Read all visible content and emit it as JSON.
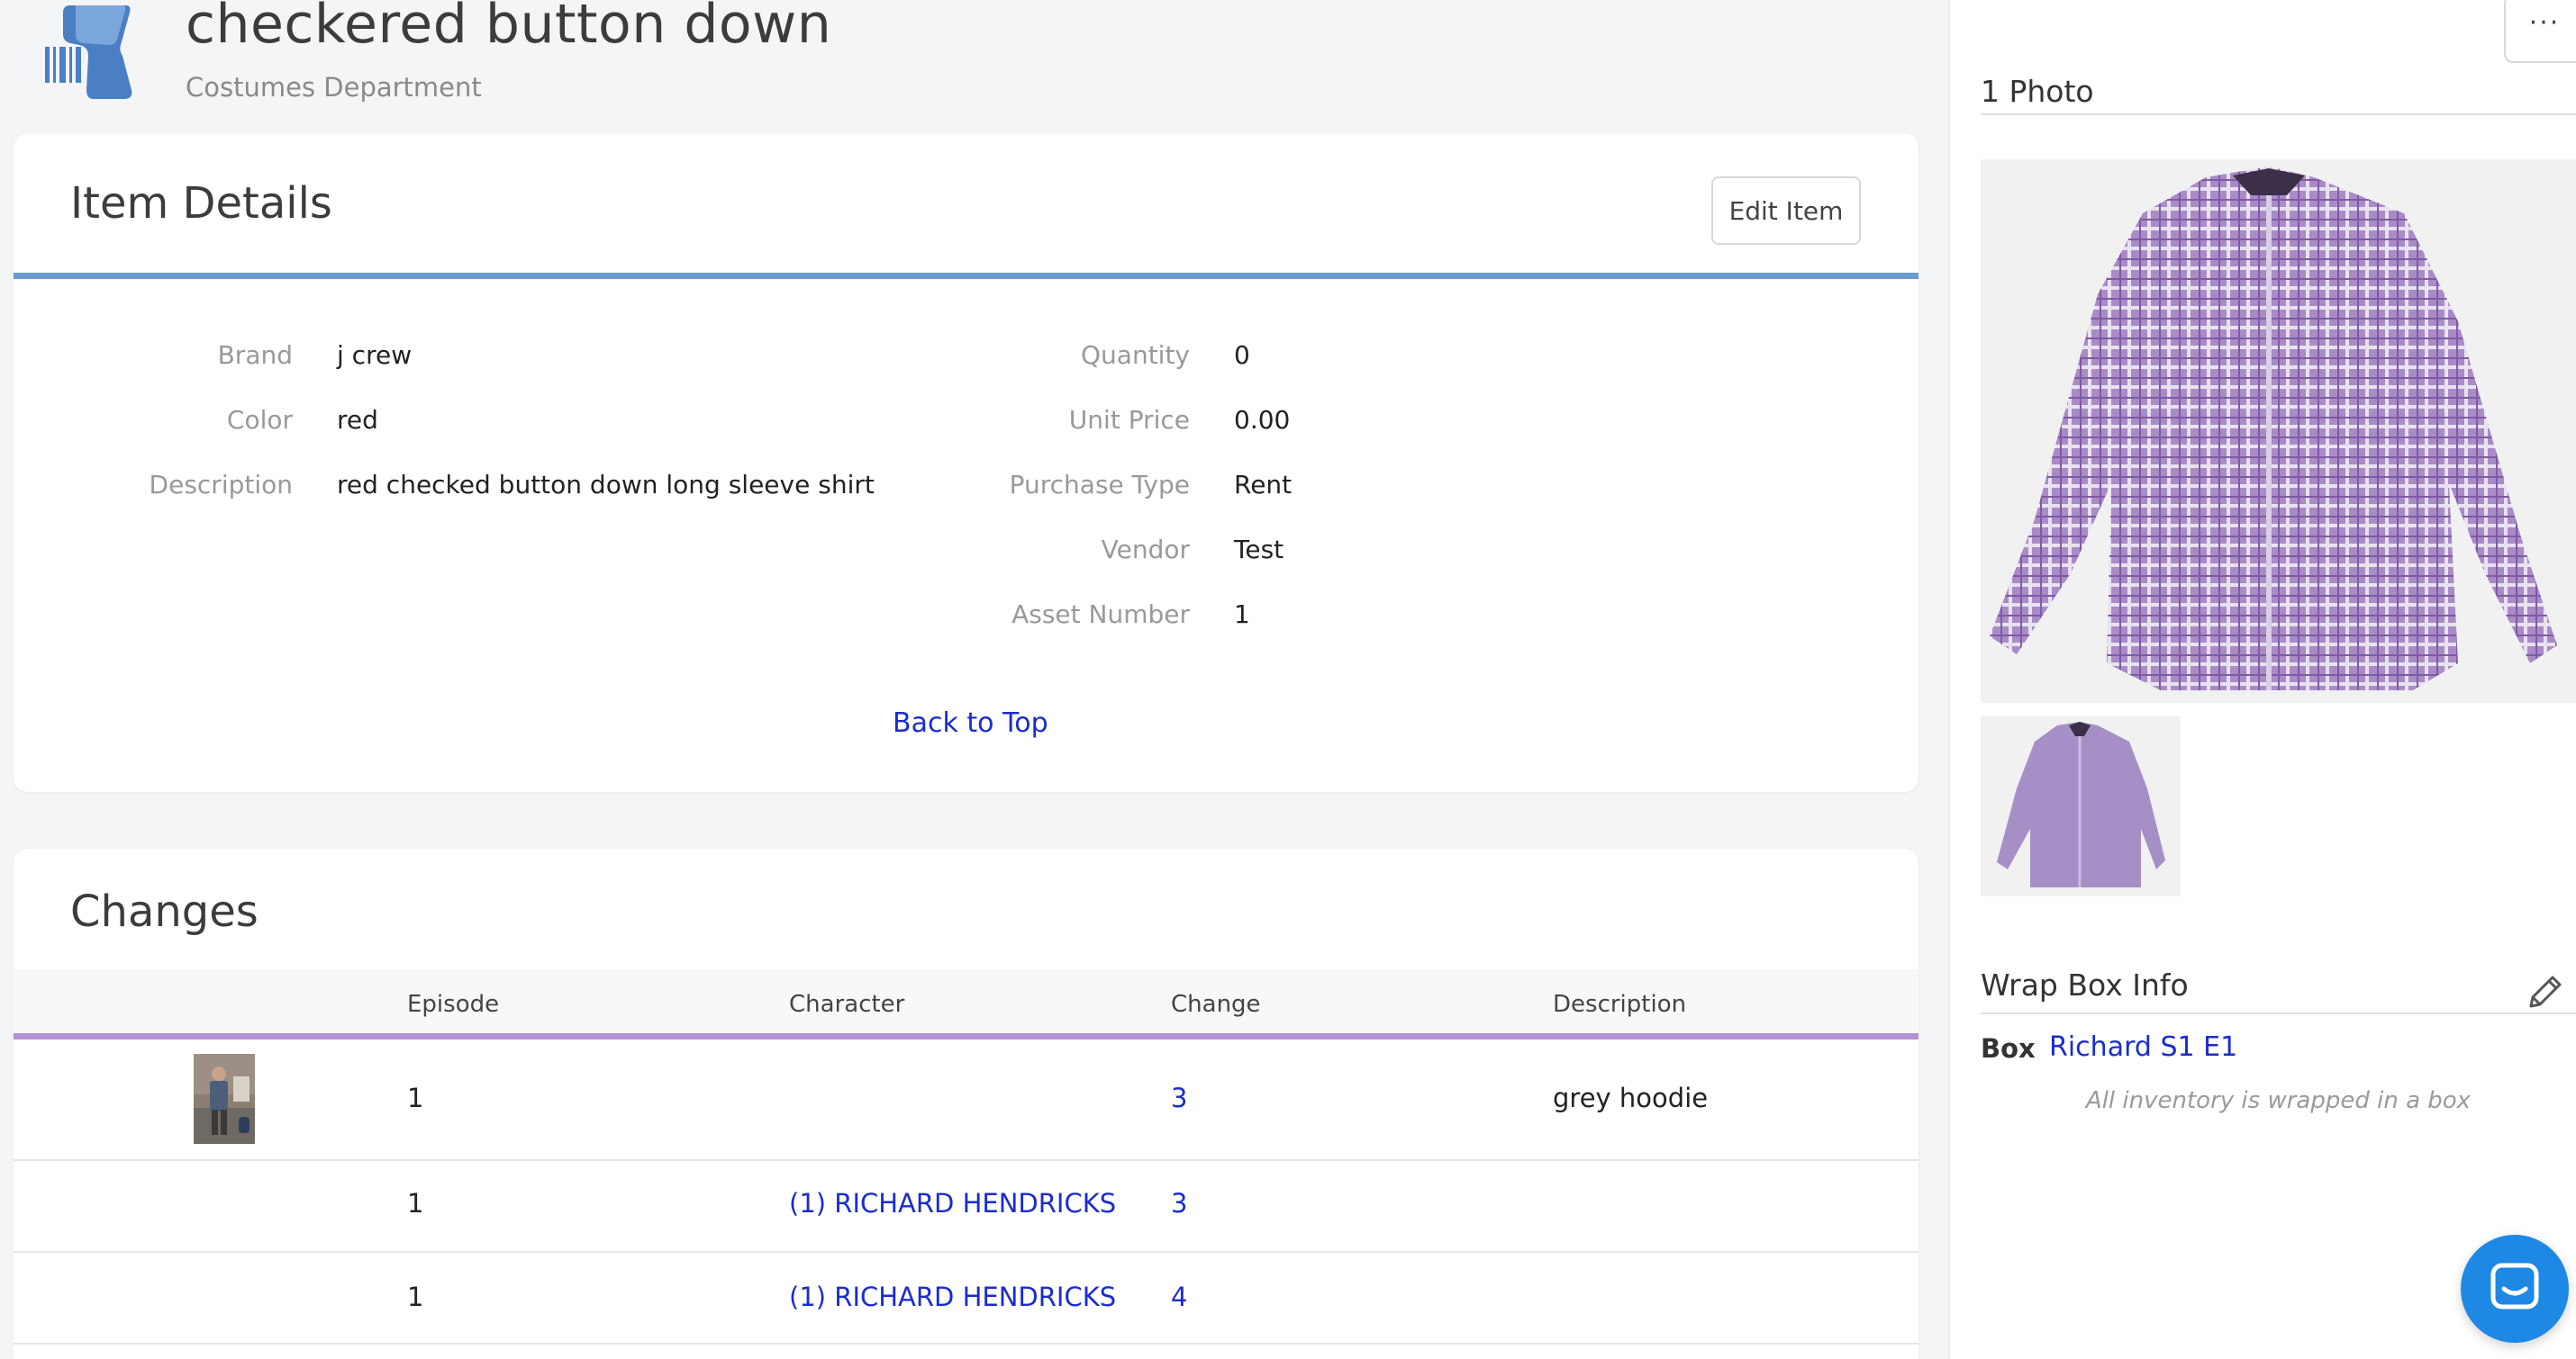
{
  "header": {
    "title": "checkered button down",
    "subtitle": "Costumes Department",
    "logo_icon": "barcode-scanner-icon"
  },
  "item_details": {
    "title": "Item Details",
    "edit_label": "Edit Item",
    "left_fields": [
      {
        "label": "Brand",
        "value": "j crew"
      },
      {
        "label": "Color",
        "value": "red"
      },
      {
        "label": "Description",
        "value": "red checked button down long sleeve shirt"
      }
    ],
    "right_fields": [
      {
        "label": "Quantity",
        "value": "0"
      },
      {
        "label": "Unit Price",
        "value": "0.00"
      },
      {
        "label": "Purchase Type",
        "value": "Rent"
      },
      {
        "label": "Vendor",
        "value": "Test"
      },
      {
        "label": "Asset Number",
        "value": "1"
      }
    ],
    "back_to_top": "Back to Top"
  },
  "changes": {
    "title": "Changes",
    "columns": [
      "Episode",
      "Character",
      "Change",
      "Description"
    ],
    "rows": [
      {
        "episode": "1",
        "character": "",
        "change": "3",
        "description": "grey hoodie",
        "has_thumb": true
      },
      {
        "episode": "1",
        "character": "(1) RICHARD HENDRICKS",
        "change": "3",
        "description": "",
        "has_thumb": false
      },
      {
        "episode": "1",
        "character": "(1) RICHARD HENDRICKS",
        "change": "4",
        "description": "",
        "has_thumb": false
      }
    ]
  },
  "sidebar": {
    "more_label": "···",
    "photos_title": "1 Photo",
    "wrap_box_title": "Wrap Box Info",
    "box_label": "Box",
    "box_value": "Richard S1 E1",
    "wrap_note": "All inventory is wrapped in a box"
  },
  "colors": {
    "accent_blue": "#6b9bd1",
    "accent_purple": "#b393d3",
    "link": "#1a2ccf",
    "chat": "#1e88e5"
  }
}
